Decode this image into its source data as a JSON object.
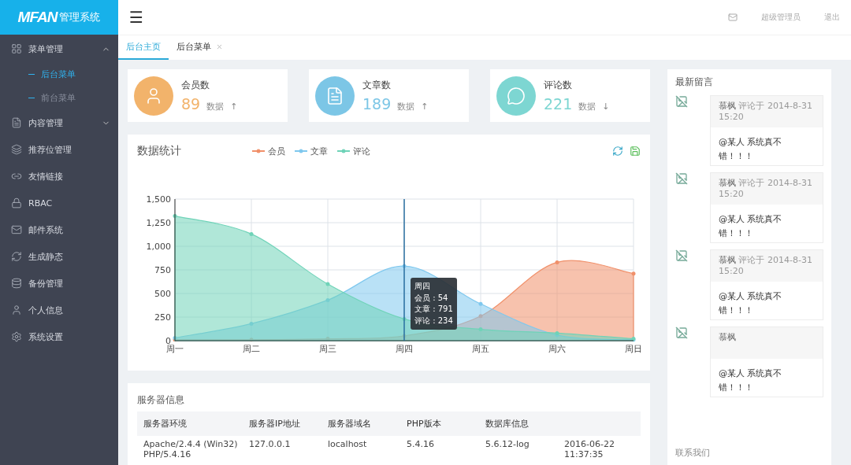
{
  "logo": {
    "brand": "MFAN",
    "suffix": "管理系统"
  },
  "sidebar": {
    "items": [
      {
        "label": "菜单管理",
        "expanded": true,
        "children": [
          {
            "label": "后台菜单",
            "selected": true
          },
          {
            "label": "前台菜单",
            "selected": false
          }
        ]
      },
      {
        "label": "内容管理",
        "expanded": false
      },
      {
        "label": "推荐位管理"
      },
      {
        "label": "友情链接"
      },
      {
        "label": "RBAC"
      },
      {
        "label": "邮件系统"
      },
      {
        "label": "生成静态"
      },
      {
        "label": "备份管理"
      },
      {
        "label": "个人信息"
      },
      {
        "label": "系统设置"
      }
    ]
  },
  "menu_button": "☰",
  "topbar": {
    "user": "超级管理员",
    "logout": "退出"
  },
  "tabs": [
    {
      "label": "后台主页",
      "selected": true,
      "closable": false
    },
    {
      "label": "后台菜单",
      "selected": false,
      "closable": true
    }
  ],
  "stats": [
    {
      "label": "会员数",
      "value": "89",
      "note": "数据",
      "arrow": "↑",
      "color": "#f2b36b"
    },
    {
      "label": "文章数",
      "value": "189",
      "note": "数据",
      "arrow": "↑",
      "color": "#7cc6e6"
    },
    {
      "label": "评论数",
      "value": "221",
      "note": "数据",
      "arrow": "↓",
      "color": "#7dd6d2"
    }
  ],
  "chart": {
    "title": "数据统计",
    "chart_data": {
      "type": "area",
      "grid": true,
      "categories": [
        "周一",
        "周二",
        "周三",
        "周四",
        "周五",
        "周六",
        "周日"
      ],
      "series": [
        {
          "name": "会员",
          "color": "#f0906a",
          "values": [
            10,
            10,
            20,
            50,
            260,
            830,
            710
          ]
        },
        {
          "name": "文章",
          "color": "#7fc8ee",
          "values": [
            30,
            180,
            430,
            790,
            390,
            60,
            10
          ]
        },
        {
          "name": "评论",
          "color": "#6fd3b8",
          "values": [
            1320,
            1130,
            600,
            230,
            120,
            80,
            20
          ]
        }
      ],
      "ylim": [
        0,
        1500
      ],
      "yticks": [
        {
          "value": 0,
          "label": "0"
        },
        {
          "value": 250,
          "label": "250"
        },
        {
          "value": 500,
          "label": "500"
        },
        {
          "value": 750,
          "label": "750"
        },
        {
          "value": 1000,
          "label": "1,000"
        },
        {
          "value": 1250,
          "label": "1,250"
        },
        {
          "value": 1500,
          "label": "1,500"
        }
      ],
      "ref_lines": [
        {
          "axis": "x",
          "value": "周四",
          "color": "#2a6fa0"
        }
      ]
    },
    "tooltip": {
      "title": "周四",
      "lines": [
        "会员 : 54",
        "文章 : 791",
        "评论 : 234"
      ]
    }
  },
  "server": {
    "title": "服务器信息",
    "columns": [
      "服务器环境",
      "服务器IP地址",
      "服务器域名",
      "PHP版本",
      "数据库信息"
    ],
    "rows": [
      [
        "Apache/2.4.4 (Win32) PHP/5.4.16",
        "127.0.0.1",
        "localhost",
        "5.4.16",
        "5.6.12-log",
        "2016-06-22 11:37:35"
      ]
    ]
  },
  "messages": {
    "title": "最新留言",
    "items": [
      {
        "meta": "**慕枫** 评论于 2014-8-31 15:20",
        "body": "@某人 系统真不错！！！"
      },
      {
        "meta": "**慕枫** 评论于 2014-8-31 15:20",
        "body": "@某人 系统真不错！！！"
      },
      {
        "meta": "**慕枫** 评论于 2014-8-31 15:20",
        "body": "@某人 系统真不错！！！"
      },
      {
        "meta": "**慕枫**",
        "body": "@某人 系统真不错！！！"
      }
    ],
    "footer": "联系我们"
  }
}
